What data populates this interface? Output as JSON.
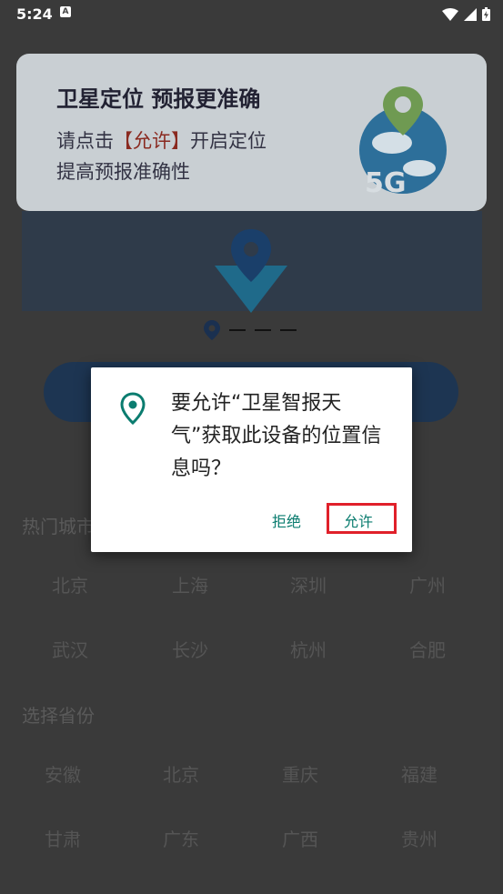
{
  "status": {
    "time": "5:24",
    "notification": "A"
  },
  "banner": {
    "title": "卫星定位 预报更准确",
    "line1_pre": "请点击",
    "line1_highlight": "【允许】",
    "line1_post": "开启定位",
    "line2": "提高预报准确性",
    "badge": "5G"
  },
  "hot_cities": {
    "title": "热门城市",
    "cities": [
      "北京",
      "上海",
      "深圳",
      "广州",
      "武汉",
      "长沙",
      "杭州",
      "合肥"
    ]
  },
  "provinces": {
    "title": "选择省份",
    "items": [
      "安徽",
      "北京",
      "重庆",
      "福建",
      "甘肃",
      "广东",
      "广西",
      "贵州"
    ]
  },
  "dialog": {
    "message": "要允许“卫星智报天气”获取此设备的位置信息吗？",
    "deny_label": "拒绝",
    "allow_label": "允许"
  },
  "colors": {
    "accent": "#0a7c6f",
    "highlight_box": "#e0202a"
  }
}
